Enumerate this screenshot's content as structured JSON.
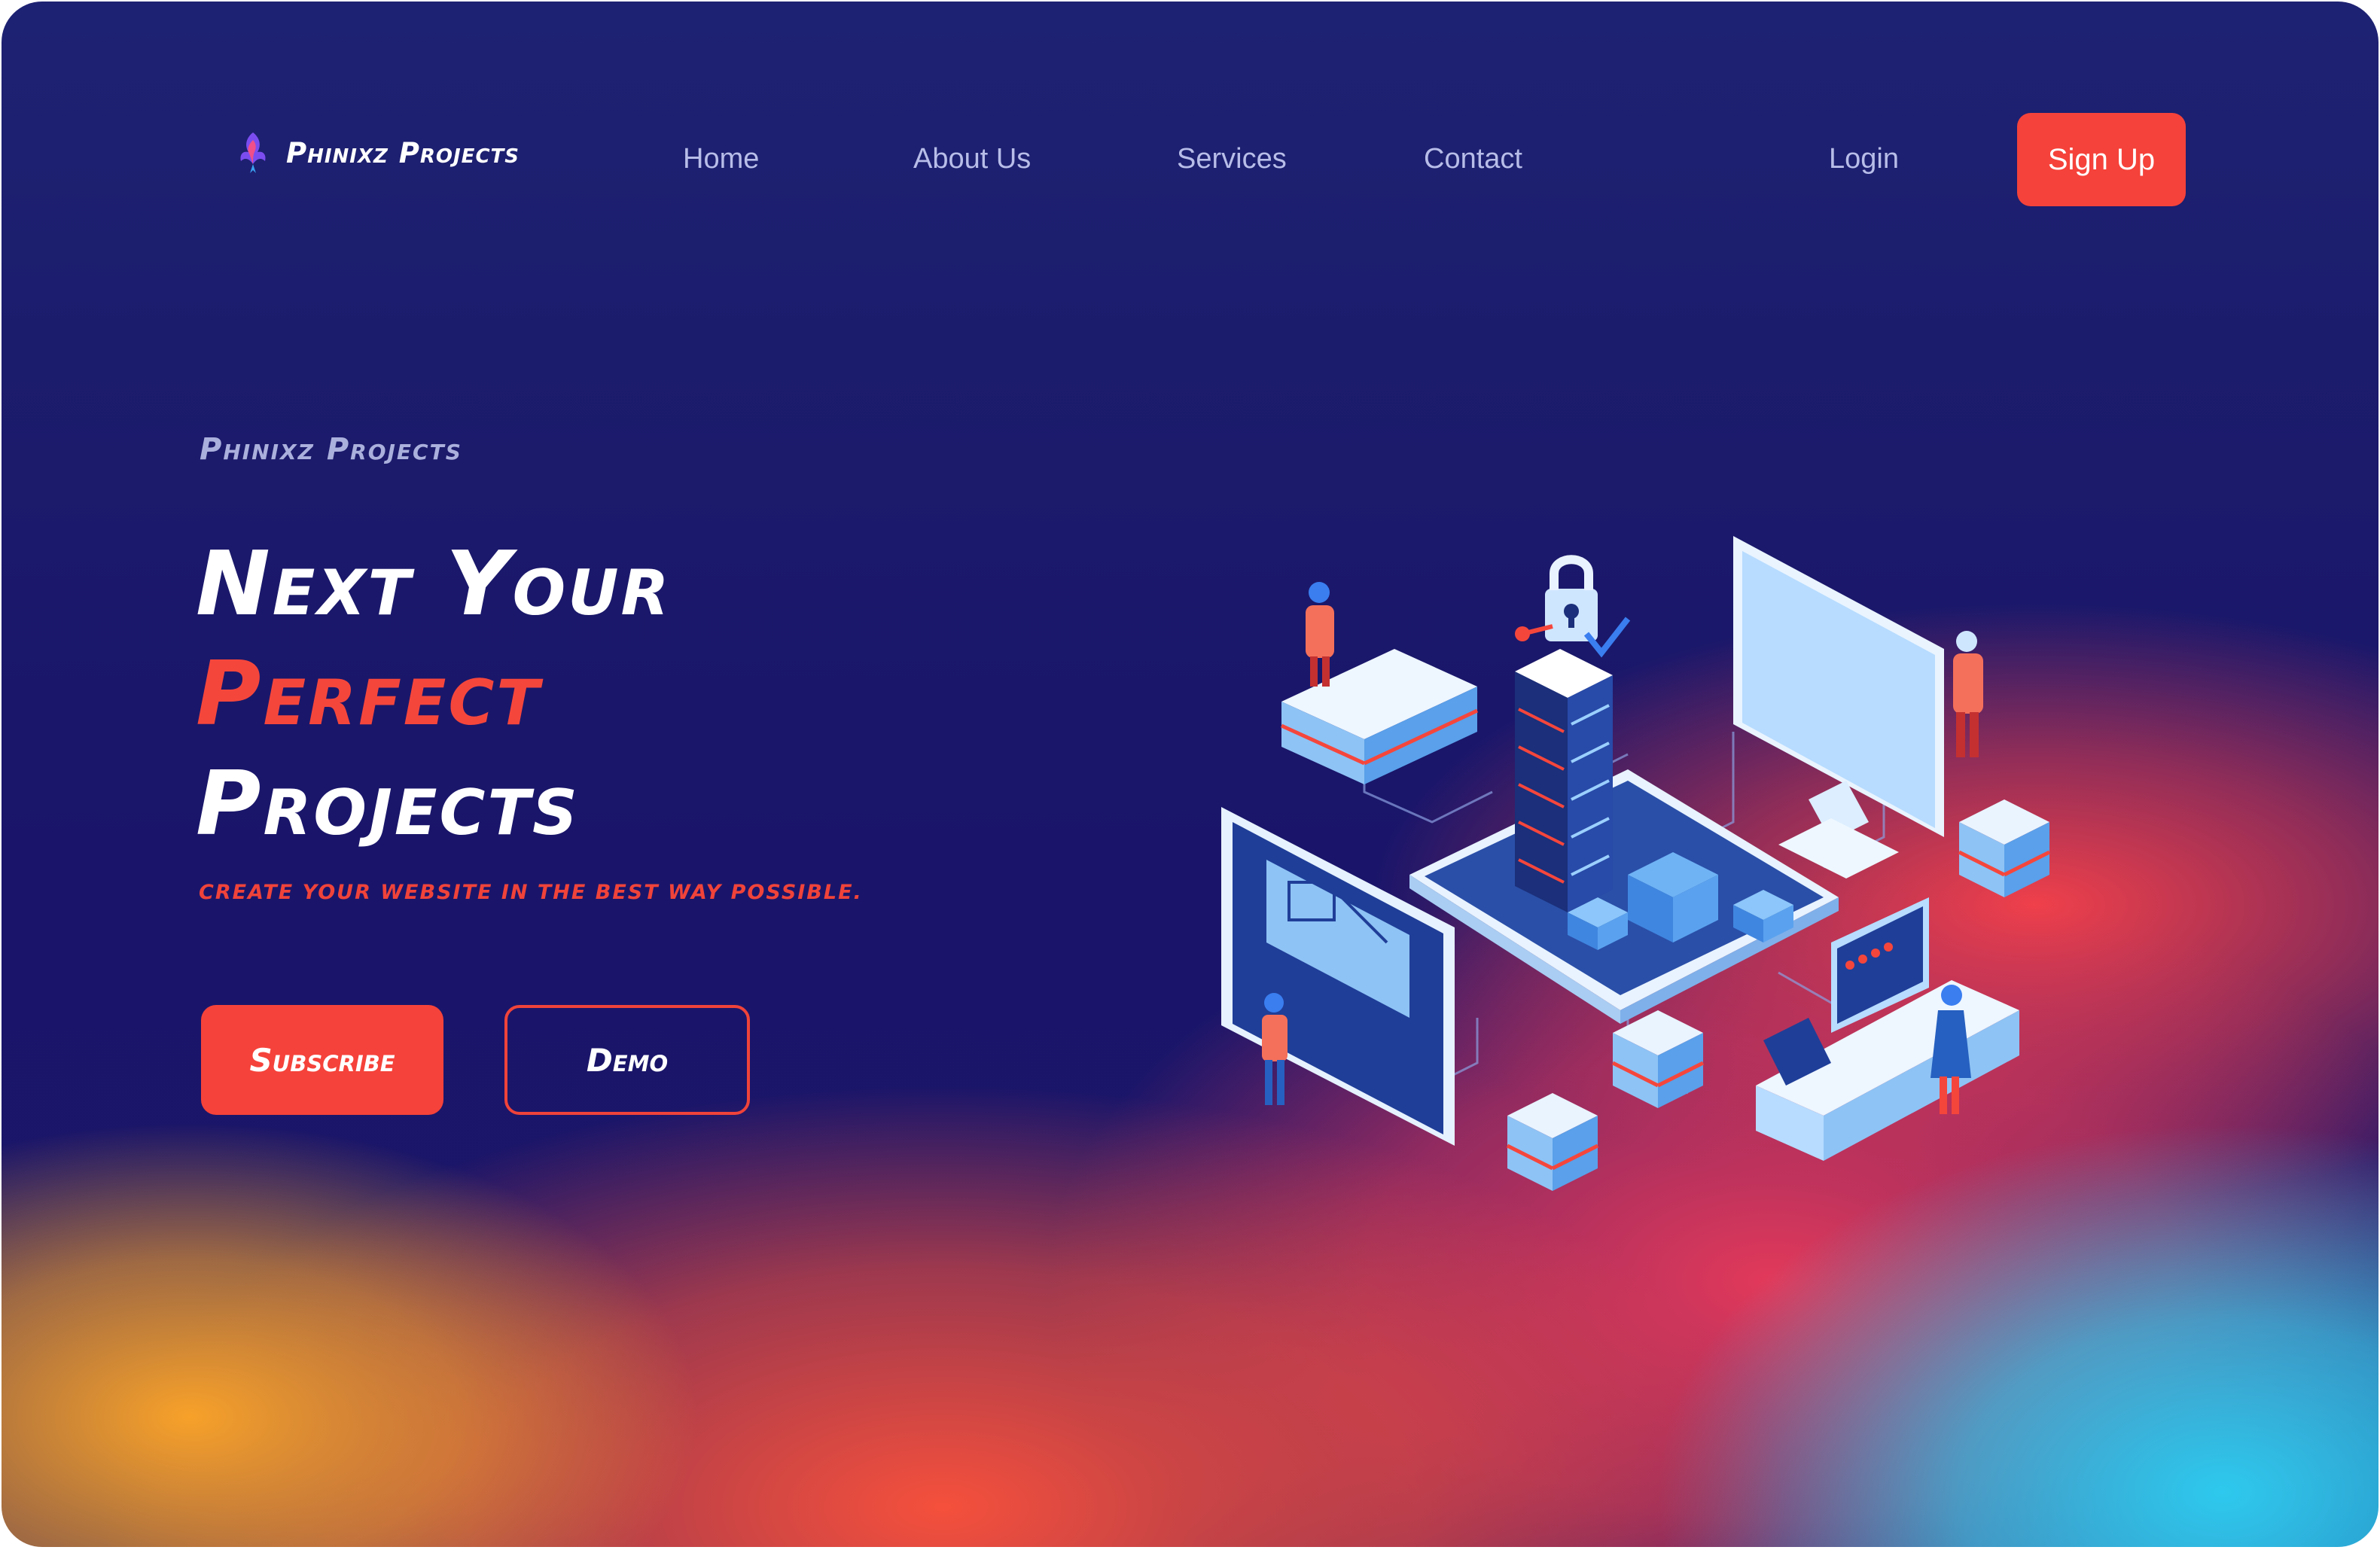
{
  "nav": {
    "logo_text": "Phinixz Projects",
    "links": [
      "Home",
      "About Us",
      "Services",
      "Contact"
    ],
    "login": "Login",
    "signup": "Sign Up"
  },
  "hero": {
    "eyebrow": "Phinixz Projects",
    "headline_line1": "Next Your",
    "headline_line2": "Perfect",
    "headline_line3": "Projects",
    "tagline": "Create your website in the best way possible.",
    "subscribe_label": "Subscribe",
    "demo_label": "Demo"
  },
  "colors": {
    "background": "#1b1a6b",
    "accent": "#f5423a",
    "nav_text": "#b7bde8"
  },
  "icons": [
    "phoenix-logo-icon"
  ]
}
